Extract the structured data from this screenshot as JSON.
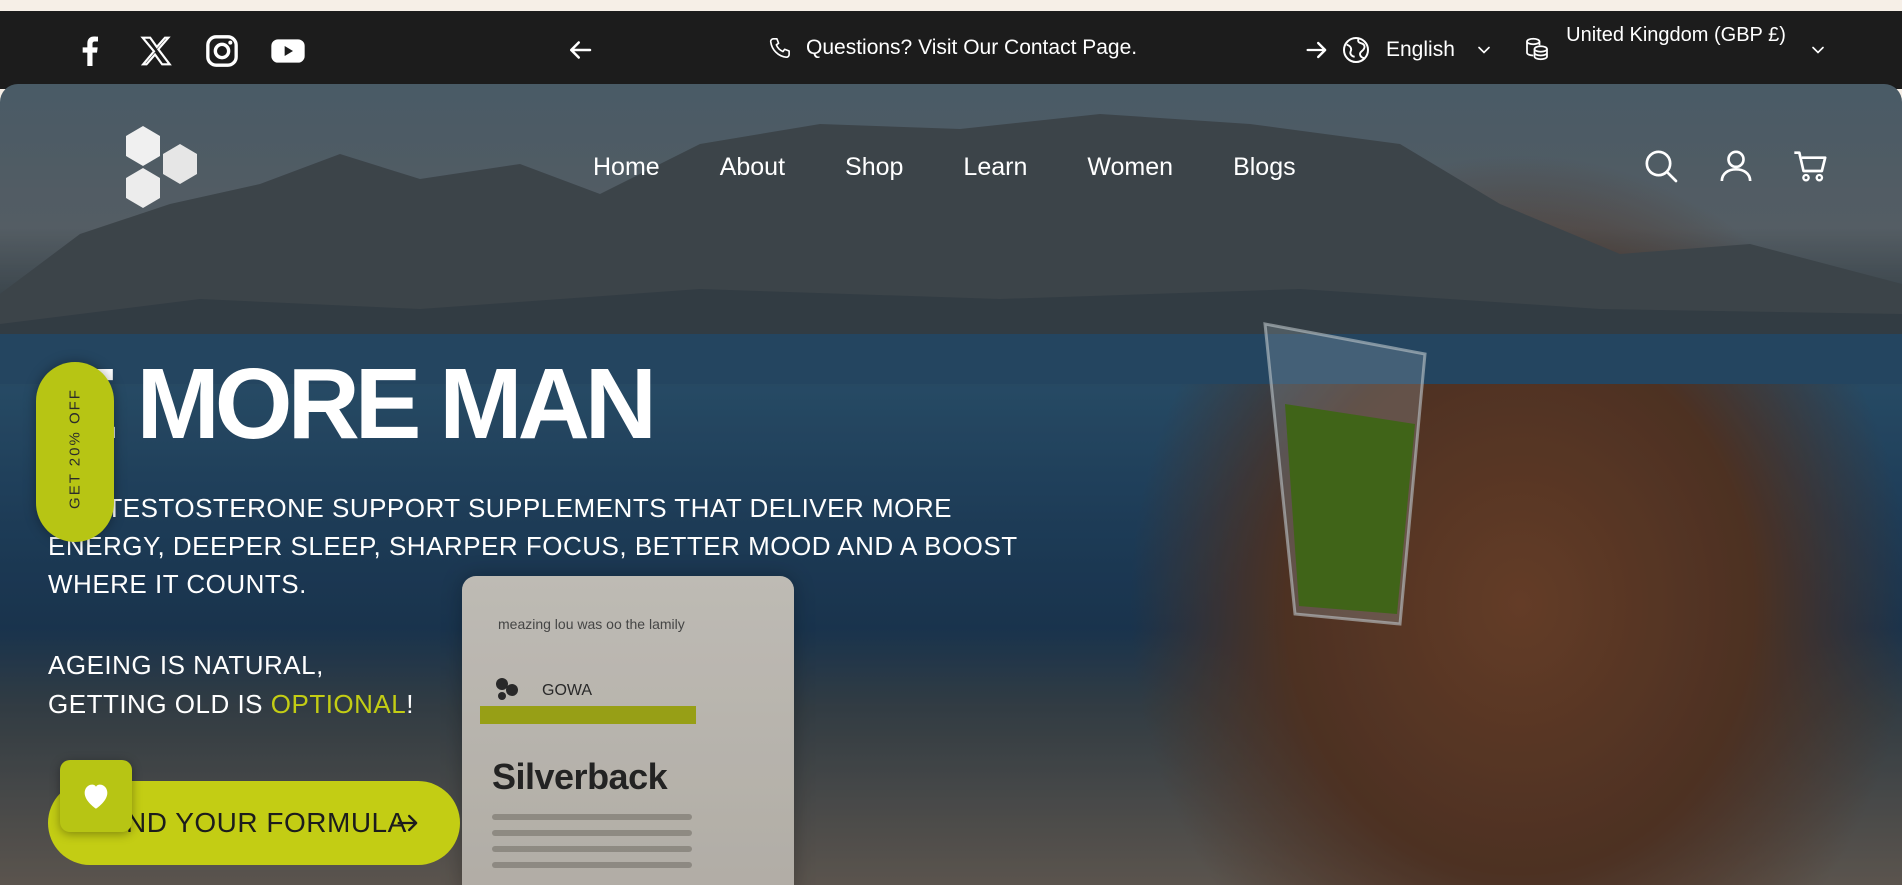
{
  "announcement": {
    "social": [
      {
        "name": "facebook-icon"
      },
      {
        "name": "x-icon"
      },
      {
        "name": "instagram-icon"
      },
      {
        "name": "youtube-icon"
      }
    ],
    "contact_text": "Questions? Visit Our Contact Page.",
    "language": "English",
    "currency": "United Kingdom (GBP £)"
  },
  "nav": {
    "items": [
      "Home",
      "About",
      "Shop",
      "Learn",
      "Women",
      "Blogs"
    ]
  },
  "hero": {
    "headline": "E MORE MAN",
    "subtitle": "RAL TESTOSTERONE SUPPORT SUPPLEMENTS THAT DELIVER MORE ENERGY, DEEPER SLEEP, SHARPER FOCUS, BETTER MOOD AND A BOOST WHERE IT COUNTS.",
    "tagline_1": "AGEING IS NATURAL,",
    "tagline_2_prefix": "GETTING OLD IS ",
    "tagline_2_accent": "OPTIONAL",
    "tagline_2_suffix": "!",
    "cta_label": "ND YOUR FORMULA",
    "product_name": "Silverback",
    "product_top_text": "meazing lou was oo the lamily",
    "product_brand": "GOWA"
  },
  "promo_tab": "GET 20% OFF",
  "colors": {
    "accent": "#c3cd14",
    "topbar": "#1c1c1c"
  }
}
